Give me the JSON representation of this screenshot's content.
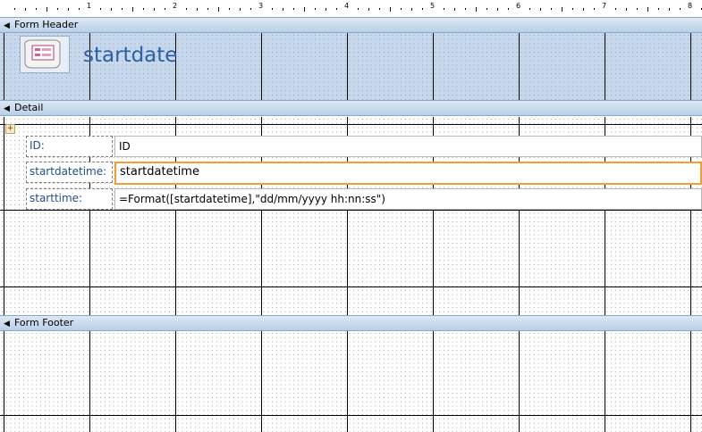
{
  "ruler": {
    "numbers": [
      "1",
      "2",
      "3",
      "4",
      "5",
      "6",
      "7",
      "8"
    ]
  },
  "sections": {
    "form_header": "Form Header",
    "detail": "Detail",
    "form_footer": "Form Footer"
  },
  "header": {
    "title": "startdate"
  },
  "detail": {
    "fields": [
      {
        "label": "ID:",
        "value": "ID"
      },
      {
        "label": "startdatetime:",
        "value": "startdatetime"
      },
      {
        "label": "starttime:",
        "value": "=Format([startdatetime],\"dd/mm/yyyy hh:nn:ss\")"
      }
    ]
  },
  "colors": {
    "selected_border": "#f0a030",
    "header_bg": "#c5d8ee",
    "label_text": "#1f4e8c"
  },
  "icons": {
    "form_icon": "form-icon",
    "section_arrow": "collapse-arrow-icon",
    "anchor": "layout-anchor-icon"
  }
}
